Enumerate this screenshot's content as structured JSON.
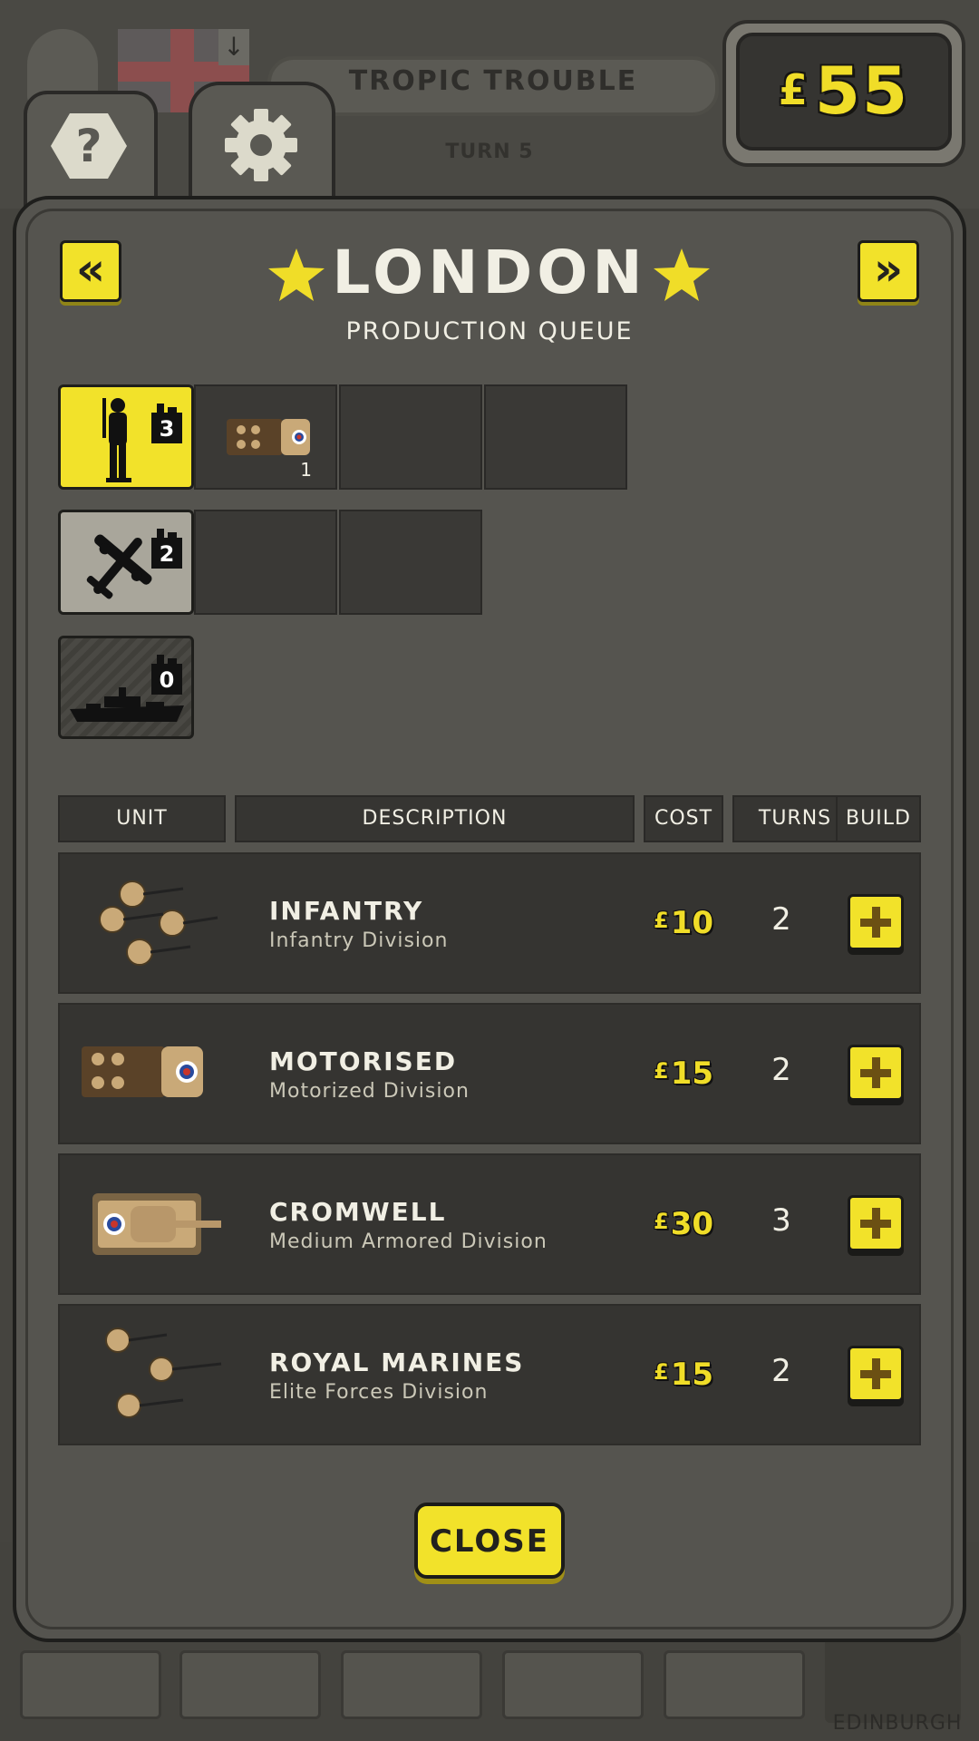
{
  "top_bar": {
    "mission_title": "TROPIC TROUBLE",
    "turn_label": "TURN 5",
    "money_symbol": "£",
    "money_value": "55"
  },
  "background": {
    "city_label": "EDINBURGH"
  },
  "tabs": [
    {
      "icon": "question-hexagon-icon",
      "label": "?"
    },
    {
      "icon": "gear-icon"
    }
  ],
  "dialog": {
    "city_name": "LONDON",
    "subtitle": "PRODUCTION QUEUE",
    "prev_label": "«",
    "next_label": "»",
    "close_label": "CLOSE"
  },
  "queues": [
    {
      "type": "land",
      "icon": "soldier-icon",
      "factory_count": "3",
      "items": [
        {
          "icon": "truck-icon",
          "count": "1"
        }
      ],
      "empty_slots": 2
    },
    {
      "type": "air",
      "icon": "plane-icon",
      "factory_count": "2",
      "items": [],
      "empty_slots": 2
    },
    {
      "type": "sea",
      "icon": "ship-icon",
      "factory_count": "0",
      "items": [],
      "empty_slots": 0
    }
  ],
  "table": {
    "headers": [
      "UNIT",
      "DESCRIPTION",
      "COST",
      "TURNS",
      "BUILD"
    ],
    "rows": [
      {
        "name": "INFANTRY",
        "desc": "Infantry Division",
        "cost_symbol": "£",
        "cost": "10",
        "turns": "2",
        "icon": "infantry-squad-icon"
      },
      {
        "name": "MOTORISED",
        "desc": "Motorized Division",
        "cost_symbol": "£",
        "cost": "15",
        "turns": "2",
        "icon": "truck-icon"
      },
      {
        "name": "CROMWELL",
        "desc": "Medium Armored Division",
        "cost_symbol": "£",
        "cost": "30",
        "turns": "3",
        "icon": "tank-icon"
      },
      {
        "name": "ROYAL MARINES",
        "desc": "Elite Forces Division",
        "cost_symbol": "£",
        "cost": "15",
        "turns": "2",
        "icon": "marines-squad-icon"
      }
    ]
  },
  "colors": {
    "accent_yellow": "#f2e22a",
    "money_yellow": "#f0dd28",
    "panel": "#55544f",
    "row": "#353431"
  }
}
